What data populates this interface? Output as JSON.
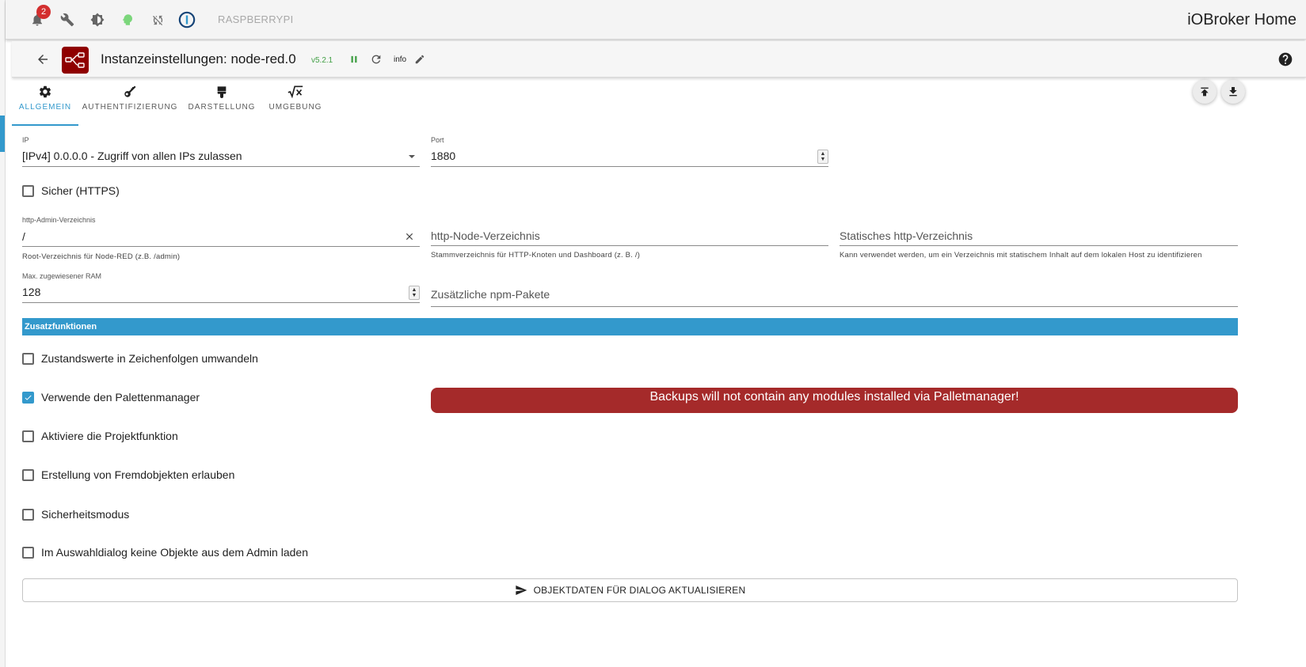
{
  "topbar": {
    "notifications_count": "2",
    "host_name": "RASPBERRYPI",
    "app_title": "iOBroker Home"
  },
  "header": {
    "title": "Instanzeinstellungen: node-red.0",
    "version": "v5.2.1",
    "loglevel": "info"
  },
  "tabs": [
    {
      "label": "ALLGEMEIN",
      "icon": "gear-icon",
      "active": true
    },
    {
      "label": "AUTHENTIFIZIERUNG",
      "icon": "key-icon",
      "active": false
    },
    {
      "label": "DARSTELLUNG",
      "icon": "brush-icon",
      "active": false
    },
    {
      "label": "UMGEBUNG",
      "icon": "sqrt-x-icon",
      "active": false
    }
  ],
  "form": {
    "ip": {
      "label": "IP",
      "value": "[IPv4] 0.0.0.0 - Zugriff von allen IPs zulassen"
    },
    "port": {
      "label": "Port",
      "value": "1880"
    },
    "https": {
      "label": "Sicher (HTTPS)",
      "checked": false
    },
    "admin_dir": {
      "label": "http-Admin-Verzeichnis",
      "value": "/",
      "helper": "Root-Verzeichnis für Node-RED (z.B. /admin)"
    },
    "node_dir": {
      "placeholder": "http-Node-Verzeichnis",
      "helper": "Stammverzeichnis für HTTP-Knoten und Dashboard (z. B. /)"
    },
    "static_dir": {
      "placeholder": "Statisches http-Verzeichnis",
      "helper": "Kann verwendet werden, um ein Verzeichnis mit statischem Inhalt auf dem lokalen Host zu identifizieren"
    },
    "max_ram": {
      "label": "Max. zugewiesener RAM",
      "value": "128"
    },
    "npm_packages": {
      "placeholder": "Zusätzliche npm-Pakete"
    }
  },
  "section": {
    "title": "Zusatzfunktionen"
  },
  "options": [
    {
      "label": "Zustandswerte in Zeichenfolgen umwandeln",
      "checked": false
    },
    {
      "label": "Verwende den Palettenmanager",
      "checked": true
    },
    {
      "label": "Aktiviere die Projektfunktion",
      "checked": false
    },
    {
      "label": "Erstellung von Fremdobjekten erlauben",
      "checked": false
    },
    {
      "label": "Sicherheitsmodus",
      "checked": false
    },
    {
      "label": "Im Auswahldialog keine Objekte aus dem Admin laden",
      "checked": false
    }
  ],
  "warning_text": "Backups will not contain any modules installed via Palletmanager!",
  "update_button_label": "OBJEKTDATEN FÜR DIALOG AKTUALISIEREN",
  "colors": {
    "accent": "#3399cc",
    "warning": "#a52a2a",
    "version": "#43a047",
    "logo": "#8f0000"
  }
}
